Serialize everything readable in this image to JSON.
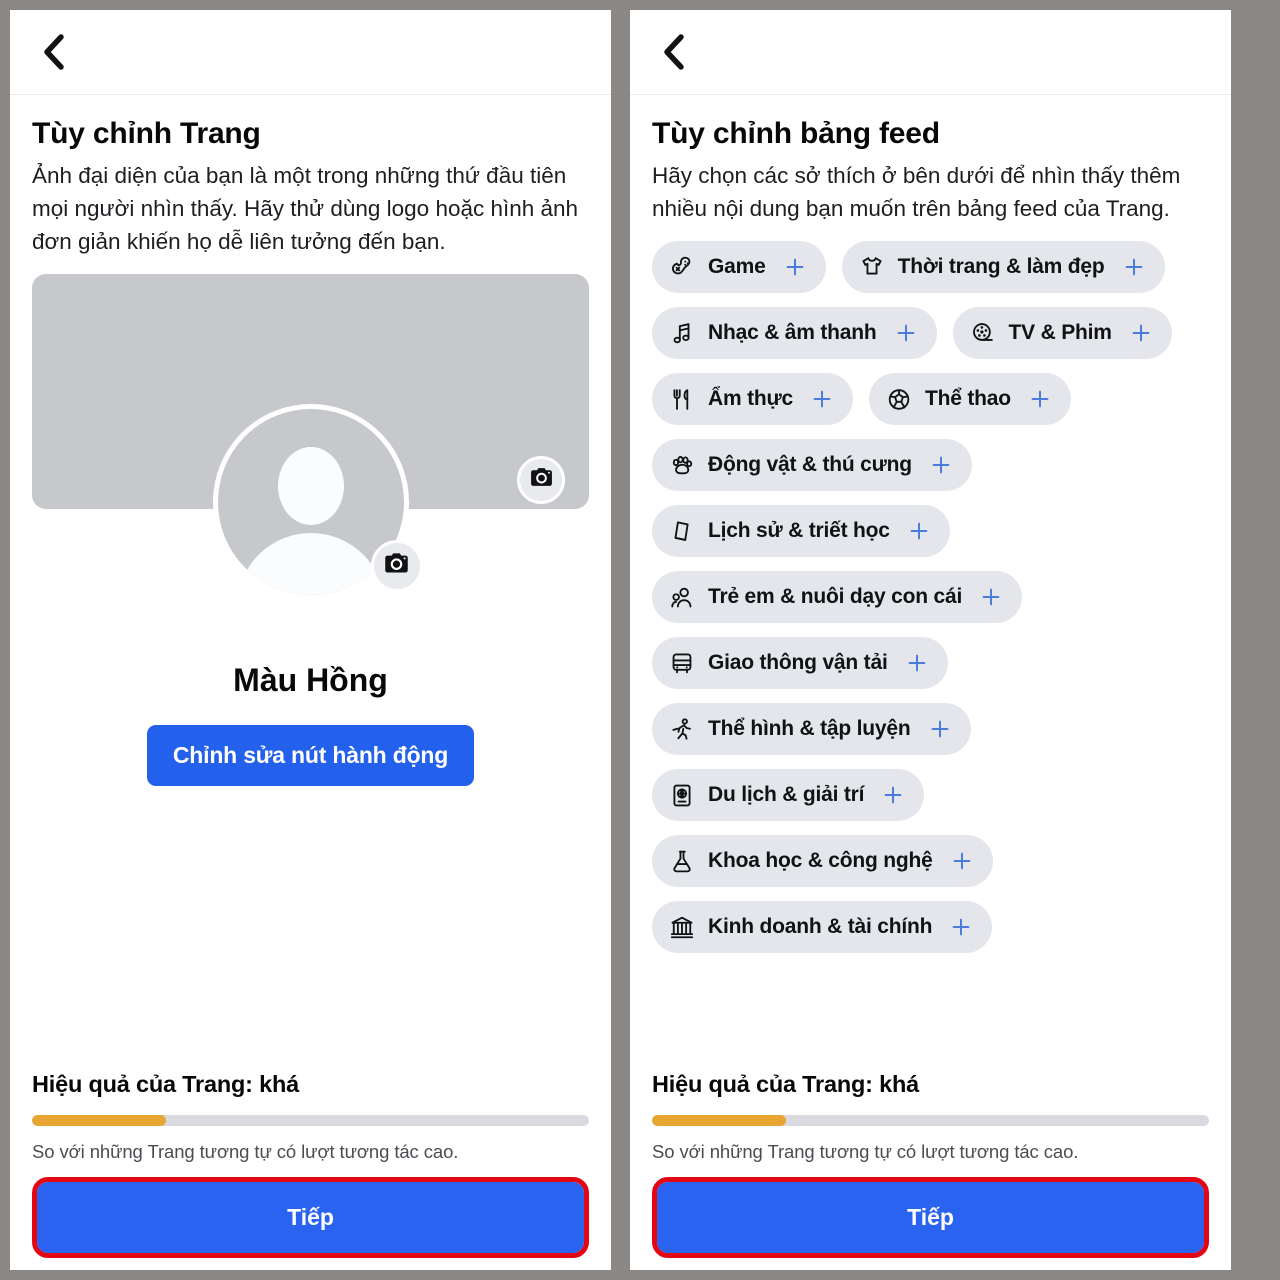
{
  "colors": {
    "accent_blue": "#2360eb",
    "next_blue": "#2a63ef",
    "highlight_red": "#e30613",
    "progress_amber": "#e8a531",
    "chip_bg": "#e4e6eb",
    "placeholder_gray": "#c6c8cc"
  },
  "left_panel": {
    "back_icon": "chevron-left-icon",
    "title": "Tùy chỉnh Trang",
    "subtitle": "Ảnh đại diện của bạn là một trong những thứ đầu tiên mọi người nhìn thấy. Hãy thử dùng logo hoặc hình ảnh đơn giản khiến họ dễ liên tưởng đến bạn.",
    "cover_camera_icon": "camera-icon",
    "avatar_camera_icon": "camera-icon",
    "page_name": "Màu Hồng",
    "action_button_label": "Chỉnh sửa nút hành động",
    "footer": {
      "performance_label": "Hiệu quả của Trang:",
      "performance_grade": "khá",
      "progress_percent": 24,
      "note": "So với những Trang tương tự có lượt tương tác cao.",
      "next_label": "Tiếp"
    }
  },
  "right_panel": {
    "back_icon": "chevron-left-icon",
    "title": "Tùy chỉnh bảng feed",
    "subtitle": "Hãy chọn các sở thích ở bên dưới để nhìn thấy thêm nhiều nội dung bạn muốn trên bảng feed của Trang.",
    "interests": [
      {
        "label": "Game",
        "icon": "gamepad-icon",
        "add_icon": "plus-icon"
      },
      {
        "label": "Thời trang & làm đẹp",
        "icon": "tshirt-icon",
        "add_icon": "plus-icon"
      },
      {
        "label": "Nhạc & âm thanh",
        "icon": "music-note-icon",
        "add_icon": "plus-icon"
      },
      {
        "label": "TV & Phim",
        "icon": "film-reel-icon",
        "add_icon": "plus-icon"
      },
      {
        "label": "Ẩm thực",
        "icon": "fork-knife-icon",
        "add_icon": "plus-icon"
      },
      {
        "label": "Thể thao",
        "icon": "soccer-ball-icon",
        "add_icon": "plus-icon"
      },
      {
        "label": "Động vật & thú cưng",
        "icon": "paw-icon",
        "add_icon": "plus-icon"
      },
      {
        "label": "Lịch sử & triết học",
        "icon": "book-icon",
        "add_icon": "plus-icon"
      },
      {
        "label": "Trẻ em & nuôi dạy con cái",
        "icon": "people-icon",
        "add_icon": "plus-icon"
      },
      {
        "label": "Giao thông vận tải",
        "icon": "bus-icon",
        "add_icon": "plus-icon"
      },
      {
        "label": "Thể hình & tập luyện",
        "icon": "running-person-icon",
        "add_icon": "plus-icon"
      },
      {
        "label": "Du lịch & giải trí",
        "icon": "passport-icon",
        "add_icon": "plus-icon"
      },
      {
        "label": "Khoa học & công nghệ",
        "icon": "flask-icon",
        "add_icon": "plus-icon"
      },
      {
        "label": "Kinh doanh & tài chính",
        "icon": "bank-icon",
        "add_icon": "plus-icon"
      }
    ],
    "footer": {
      "performance_label": "Hiệu quả của Trang:",
      "performance_grade": "khá",
      "progress_percent": 24,
      "note": "So với những Trang tương tự có lượt tương tác cao.",
      "next_label": "Tiếp"
    }
  }
}
